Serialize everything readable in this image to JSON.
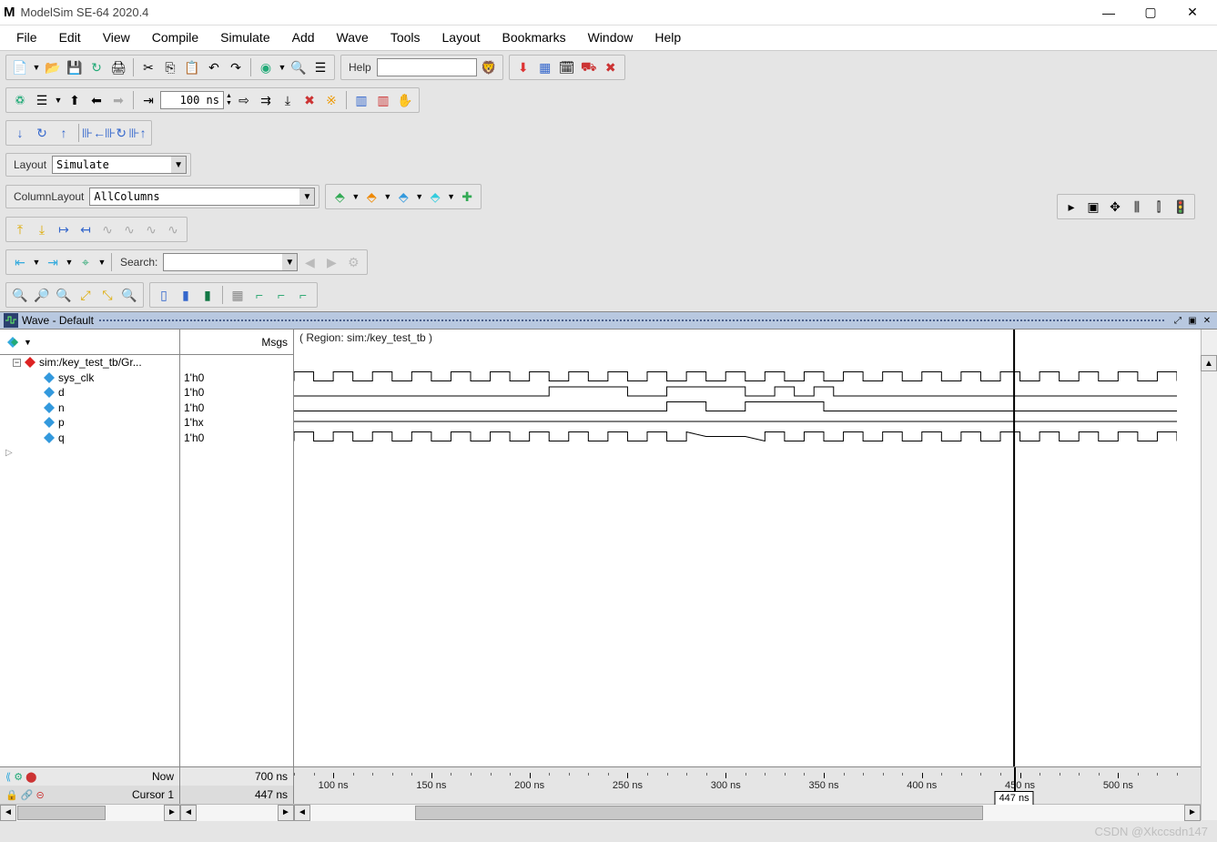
{
  "app": {
    "logo": "M",
    "title": "ModelSim SE-64 2020.4"
  },
  "menu": [
    "File",
    "Edit",
    "View",
    "Compile",
    "Simulate",
    "Add",
    "Wave",
    "Tools",
    "Layout",
    "Bookmarks",
    "Window",
    "Help"
  ],
  "toolbar": {
    "help_label": "Help",
    "run_time": "100 ns",
    "layout_label": "Layout",
    "layout_value": "Simulate",
    "column_label": "ColumnLayout",
    "column_value": "AllColumns",
    "search_label": "Search:"
  },
  "wave": {
    "title": "Wave - Default",
    "msgs_header": "Msgs",
    "region": "( Region: sim:/key_test_tb )",
    "root": "sim:/key_test_tb/Gr...",
    "signals": [
      {
        "name": "sys_clk",
        "value": "1'h0"
      },
      {
        "name": "d",
        "value": "1'h0"
      },
      {
        "name": "n",
        "value": "1'h0"
      },
      {
        "name": "p",
        "value": "1'hx"
      },
      {
        "name": "q",
        "value": "1'h0"
      }
    ],
    "now_label": "Now",
    "now_value": "700 ns",
    "cursor_label": "Cursor 1",
    "cursor_value": "447 ns",
    "cursor_box": "447 ns",
    "time_ticks": [
      "100 ns",
      "150 ns",
      "200 ns",
      "250 ns",
      "300 ns",
      "350 ns",
      "400 ns",
      "450 ns",
      "500 ns"
    ],
    "time_values_ns": [
      100,
      150,
      200,
      250,
      300,
      350,
      400,
      450,
      500
    ],
    "view_start_ns": 80,
    "view_end_ns": 530,
    "cursor_pos_ns": 447
  },
  "watermark": "CSDN @Xkccsdn147"
}
